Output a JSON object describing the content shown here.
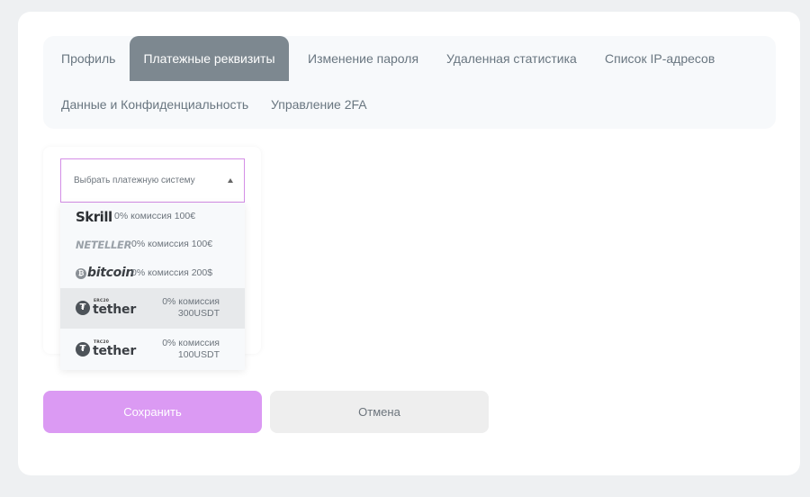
{
  "tabs": [
    {
      "label": "Профиль",
      "active": false
    },
    {
      "label": "Платежные реквизиты",
      "active": true
    },
    {
      "label": "Изменение пароля",
      "active": false
    },
    {
      "label": "Удаленная статистика",
      "active": false
    },
    {
      "label": "Список IP-адресов",
      "active": false
    },
    {
      "label": "Данные и Конфиденциальность",
      "active": false
    },
    {
      "label": "Управление 2FA",
      "active": false
    }
  ],
  "payment_select": {
    "placeholder": "Выбрать платежную систему",
    "options": [
      {
        "logo": "Skrill",
        "commission": "0% комиссия 100€"
      },
      {
        "logo": "NETELLER",
        "commission": "0% комиссия 100€"
      },
      {
        "logo_symbol": "₿",
        "logo": "bitcoin",
        "commission": "0% комиссия 200$"
      },
      {
        "logo_tag": "ERC20",
        "logo": "tether",
        "commission_line1": "0% комиссия",
        "commission_line2": "300USDT",
        "highlighted": true
      },
      {
        "logo_tag": "TRC20",
        "logo": "tether",
        "commission_line1": "0% комиссия",
        "commission_line2": "100USDT",
        "highlighted": false
      }
    ]
  },
  "buttons": {
    "save": "Сохранить",
    "cancel": "Отмена"
  },
  "colors": {
    "active_tab": "#7d8890",
    "save_button": "#db9af3",
    "select_border": "#d48ee6"
  }
}
